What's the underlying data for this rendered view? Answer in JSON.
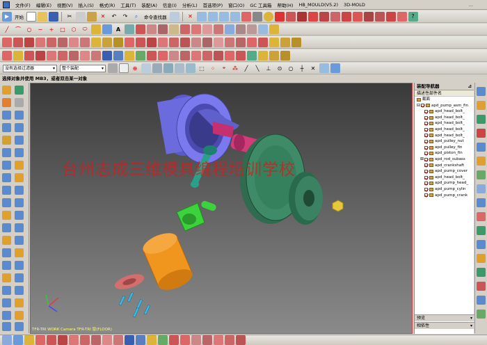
{
  "menu": {
    "items": [
      "文件(F)",
      "编辑(E)",
      "视图(V)",
      "插入(S)",
      "格式(R)",
      "工具(T)",
      "装配(A)",
      "信息(I)",
      "分析(L)",
      "首选项(P)",
      "窗口(O)",
      "GC 工具箱",
      "帮助(H)",
      "HB_MOULD(V5.2)",
      "3D-MOLD"
    ],
    "title": "..."
  },
  "toolbar": {
    "start_label": "开始",
    "command_finder_label": "命令查找器",
    "filter_select": "没有选择过滤器",
    "assembly_select": "整个装配"
  },
  "status": {
    "prompt": "选择对象并使用 MB3，或者双击某一对象"
  },
  "viewport": {
    "watermark": "台州志成三维模具编程培训学校",
    "caption": "TFR-TRI WORK Camera TFR-TRI 窗(FLOOR)"
  },
  "nav": {
    "title": "装配导航器",
    "column_header": "描述性部件名",
    "section_label": "截面",
    "root": "apd_pump_asm_fin",
    "parts": [
      "apd_head_bolt_",
      "apd_head_bolt_",
      "apd_head_bolt_",
      "apd_head_bolt_",
      "apd_head_bolt_",
      "apd_pulley_nut",
      "apd_pulley_fin",
      "apd_piston_fin",
      "apd_rod_subass",
      "apd_crankshaft",
      "apd_pump_cover",
      "apd_head_bolt_",
      "apd_pump_head_",
      "apd_pump_cylin",
      "apd_pump_crank"
    ],
    "preview_label": "预览",
    "dependency_label": "相依性"
  },
  "colors": {
    "viewport_top": "#3a3a3a",
    "viewport_bottom": "#8a8a8a",
    "watermark": "#d21e1e",
    "crankcase": "#7a7aee",
    "pulley": "#3f8a67",
    "cylinder": "#f0961e",
    "piston": "#3cd23c",
    "crankshaft": "#d23c78",
    "rod": "#2aa08a",
    "head": "#d26e6e",
    "nut": "#e6c83c"
  }
}
